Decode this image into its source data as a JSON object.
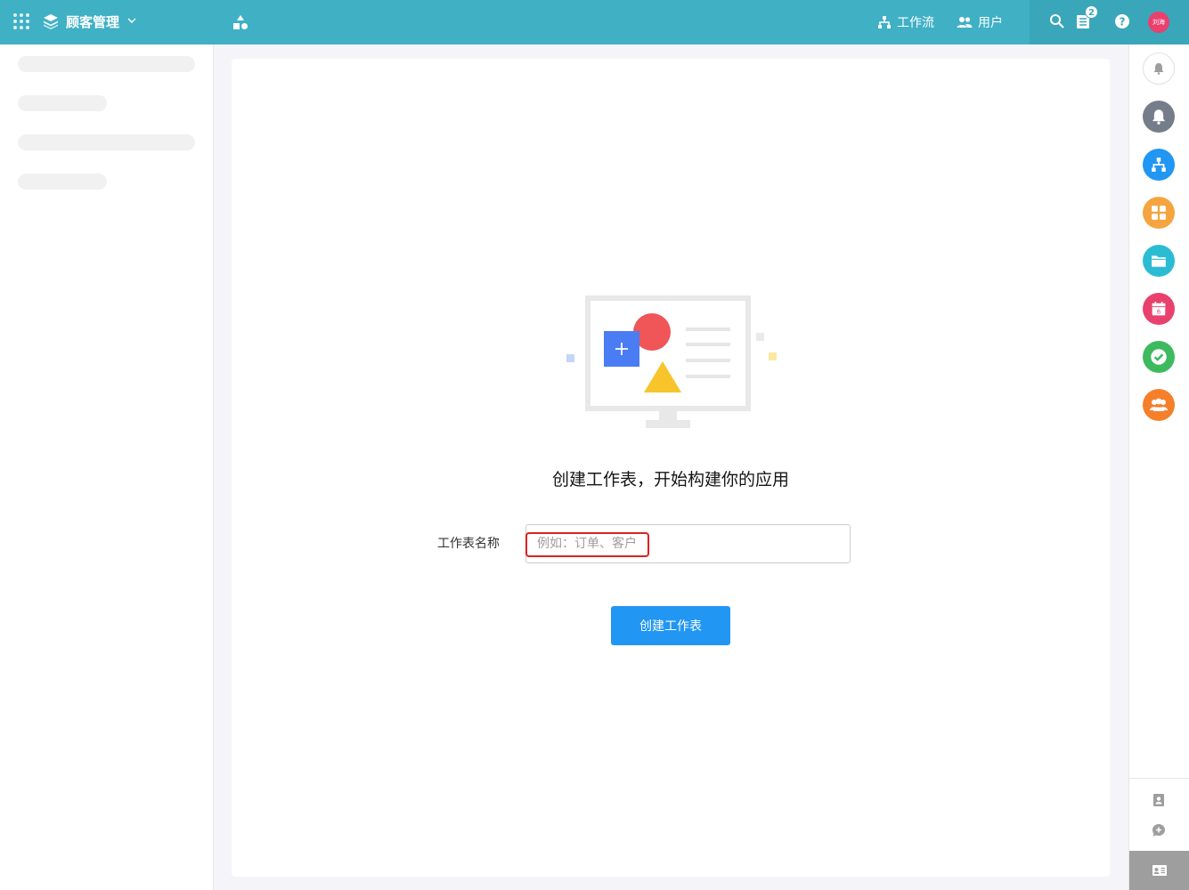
{
  "header": {
    "app_title": "顾客管理",
    "nav": [
      {
        "label": "工作流",
        "icon": "workflow-icon"
      },
      {
        "label": "用户",
        "icon": "users-icon"
      }
    ],
    "notification_count": "2",
    "avatar_text": "刘海"
  },
  "sidebar": {
    "loading_rows": 4
  },
  "main": {
    "empty_title": "创建工作表，开始构建你的应用",
    "field_label": "工作表名称",
    "field_placeholder": "例如：订单、客户",
    "field_value": "",
    "create_button": "创建工作表"
  },
  "right_rail": {
    "items": [
      {
        "name": "notification-bell-outline-icon",
        "color": "#ffffff"
      },
      {
        "name": "notification-bell-icon",
        "color": "#757d8a"
      },
      {
        "name": "workflow-hierarchy-icon",
        "color": "#2196f3"
      },
      {
        "name": "app-grid-icon",
        "color": "#f5a540"
      },
      {
        "name": "folder-icon",
        "color": "#2bbcd4"
      },
      {
        "name": "calendar-icon",
        "color": "#e8416e",
        "text": "6"
      },
      {
        "name": "task-check-icon",
        "color": "#3dba5e"
      },
      {
        "name": "contacts-group-icon",
        "color": "#f57f2a"
      }
    ],
    "bottom_items": [
      "address-book-icon",
      "chat-add-icon",
      "id-card-icon"
    ]
  },
  "colors": {
    "header_bg": "#40b0c5",
    "primary": "#2196f3",
    "highlight": "#e02020"
  }
}
